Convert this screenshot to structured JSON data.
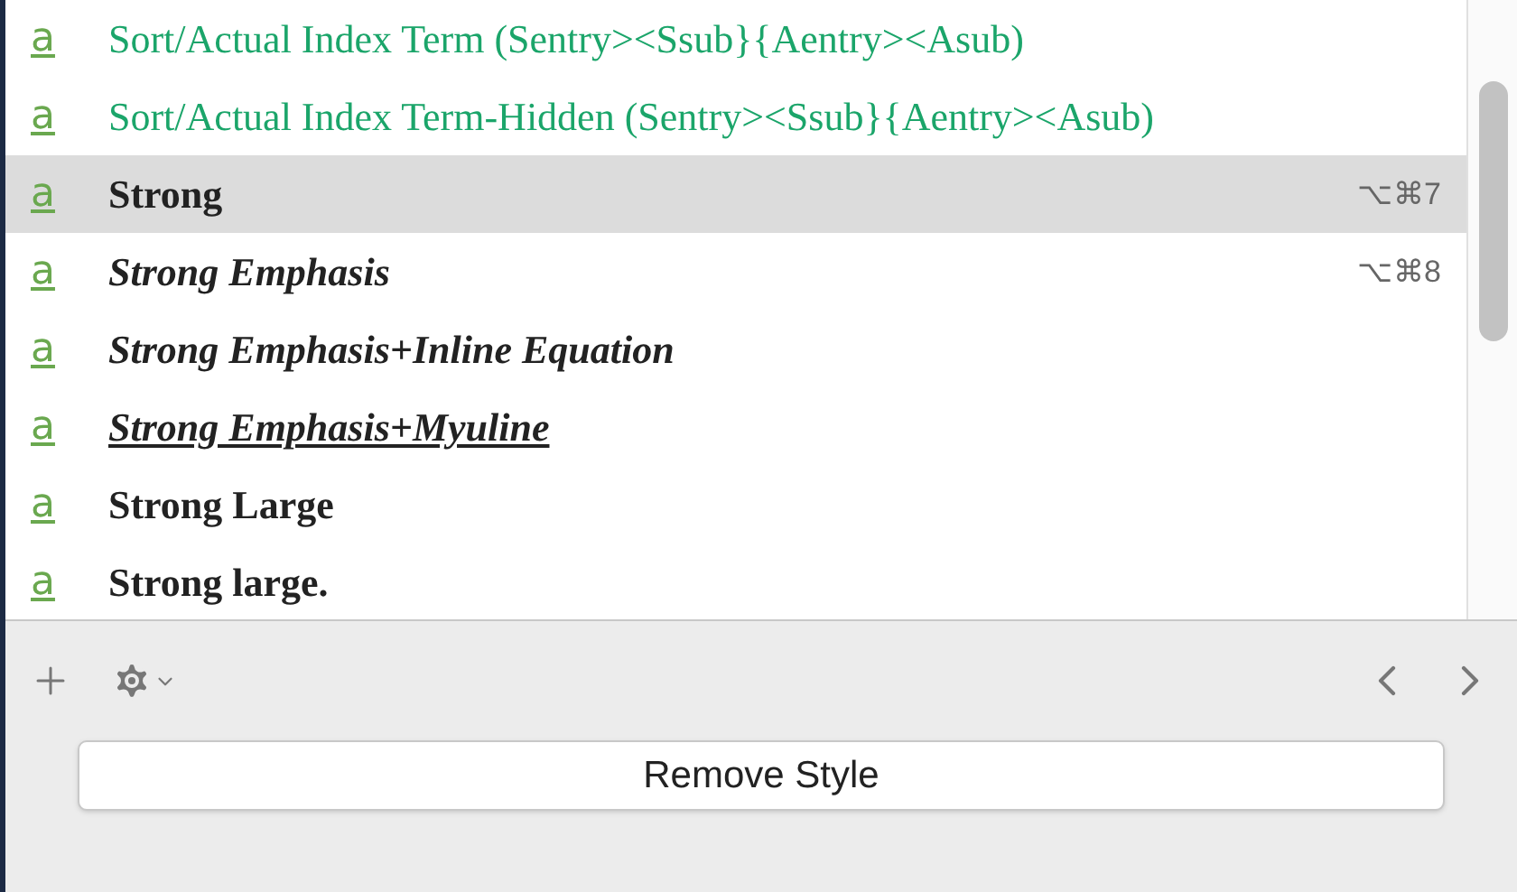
{
  "styles": [
    {
      "icon": "a",
      "name": "Sort/Actual Index Term (Sentry><Ssub}{Aentry><Asub)",
      "kind": "green",
      "selected": false
    },
    {
      "icon": "a",
      "name": "Sort/Actual Index Term-Hidden (Sentry><Ssub}{Aentry><Asub)",
      "kind": "green",
      "selected": false
    },
    {
      "icon": "a",
      "name": "Strong",
      "kind": "bold",
      "selected": true,
      "shortcut": "⌥⌘7"
    },
    {
      "icon": "a",
      "name": "Strong Emphasis",
      "kind": "bold-italic",
      "selected": false,
      "shortcut": "⌥⌘8"
    },
    {
      "icon": "a",
      "name": "Strong Emphasis+Inline Equation",
      "kind": "bold-italic",
      "selected": false
    },
    {
      "icon": "a",
      "name": "Strong Emphasis+Myuline",
      "kind": "bold-italic-underline",
      "selected": false
    },
    {
      "icon": "a",
      "name": "Strong Large",
      "kind": "bold",
      "selected": false
    },
    {
      "icon": "a",
      "name": "Strong large.",
      "kind": "bold",
      "selected": false
    }
  ],
  "remove_button": "Remove Style"
}
